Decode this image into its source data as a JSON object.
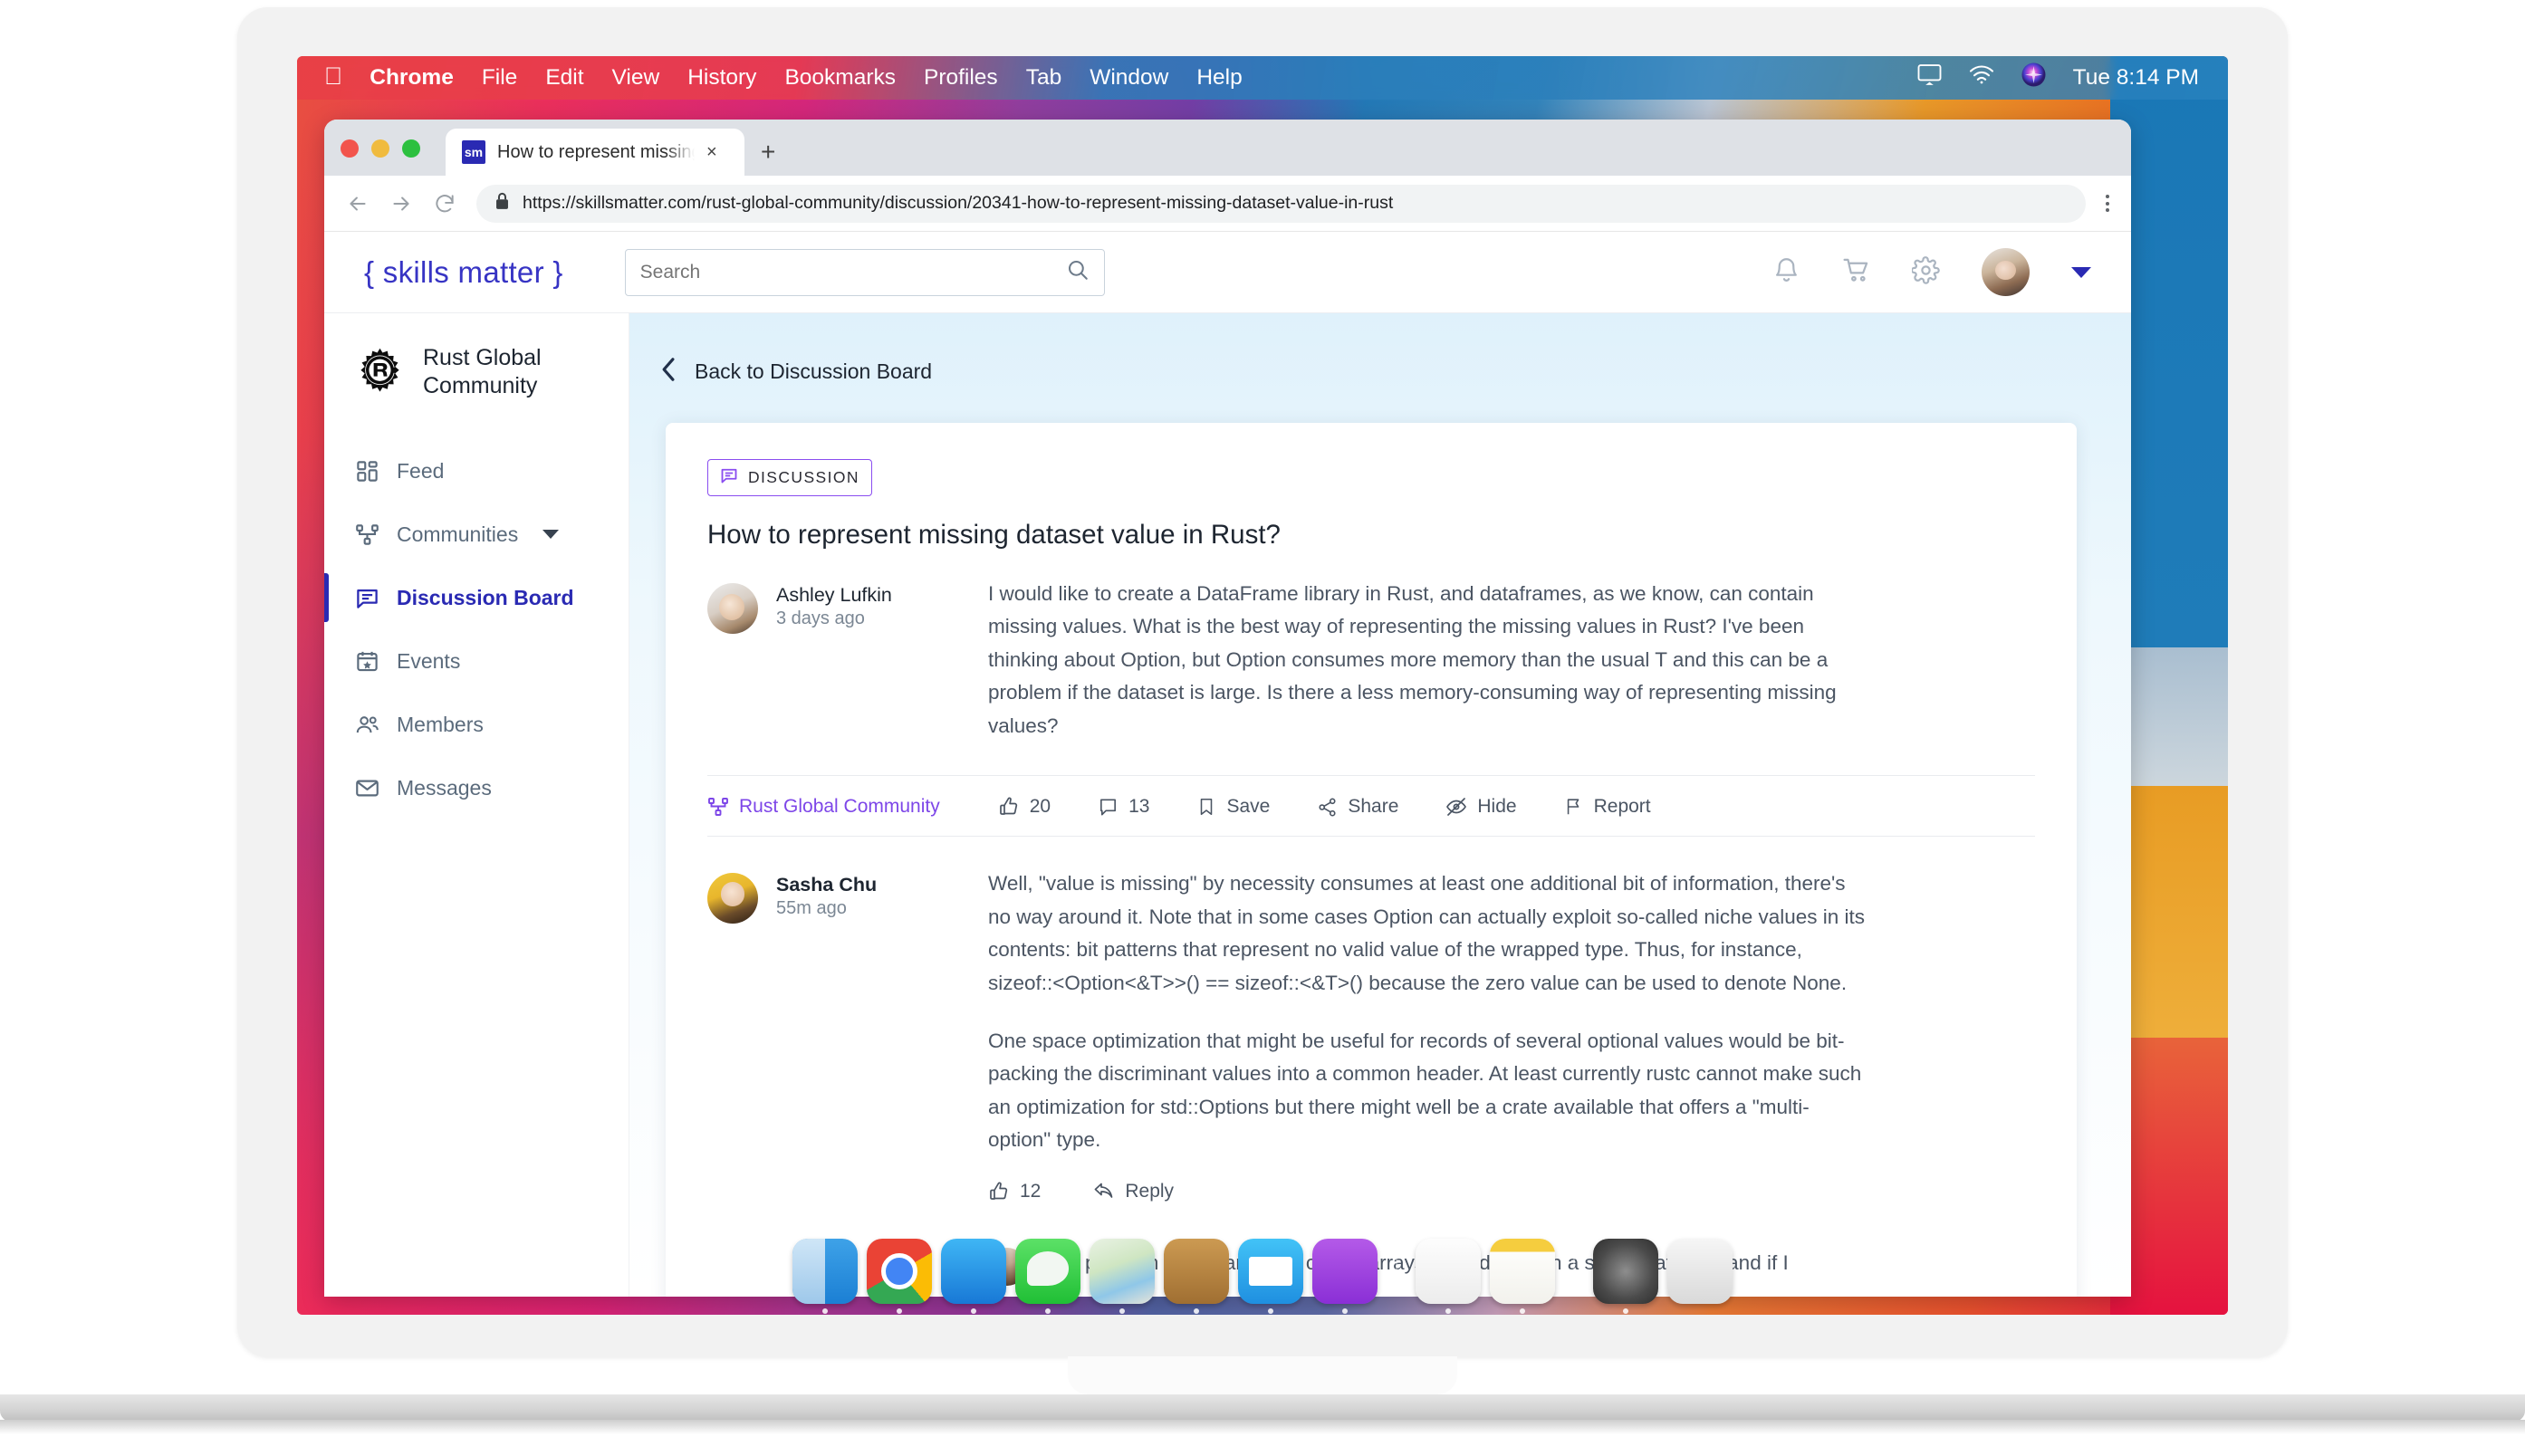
{
  "macos": {
    "apple_logo": "",
    "menu_items": [
      "Chrome",
      "File",
      "Edit",
      "View",
      "History",
      "Bookmarks",
      "Profiles",
      "Tab",
      "Window",
      "Help"
    ],
    "status_icons": [
      "airplay-icon",
      "wifi-icon",
      "siri-icon"
    ],
    "clock": "Tue 8:14 PM"
  },
  "browser": {
    "tab": {
      "favicon_text": "sm",
      "title": "How to represent missing dat",
      "close_label": "×"
    },
    "new_tab_label": "+",
    "nav": {
      "back": "←",
      "forward": "→",
      "reload": "⟳"
    },
    "omnibox": {
      "lock_icon": "lock-icon",
      "url": "https://skillsmatter.com/rust-global-community/discussion/20341-how-to-represent-missing-dataset-value-in-rust"
    },
    "menu_label": "⋮"
  },
  "site_header": {
    "logo": "{ skills matter }",
    "search": {
      "value": "",
      "placeholder": "Search"
    },
    "icons": [
      "bell-icon",
      "cart-icon",
      "gear-icon"
    ],
    "avatar_name": "avatar",
    "caret": "chevron-down-icon"
  },
  "sidebar": {
    "community": {
      "logo": "rust-logo",
      "name": "Rust Global Community"
    },
    "items": [
      {
        "label": "Feed",
        "icon": "grid-icon",
        "active": false,
        "caret": false
      },
      {
        "label": "Communities",
        "icon": "network-icon",
        "active": false,
        "caret": true
      },
      {
        "label": "Discussion Board",
        "icon": "chat-icon",
        "active": true,
        "caret": false
      },
      {
        "label": "Events",
        "icon": "calendar-icon",
        "active": false,
        "caret": false
      },
      {
        "label": "Members",
        "icon": "people-icon",
        "active": false,
        "caret": false
      },
      {
        "label": "Messages",
        "icon": "envelope-icon",
        "active": false,
        "caret": false
      }
    ]
  },
  "main": {
    "back_link": "Back to Discussion Board",
    "badge": "DISCUSSION",
    "post": {
      "title": "How to represent missing dataset value in Rust?",
      "author": "Ashley Lufkin",
      "time": "3 days ago",
      "body": "I would like to create a DataFrame library in Rust, and dataframes, as we know, can contain missing values. What is the best way of representing the missing values in Rust? I've been thinking about Option, but Option consumes more memory than the usual T and this can be a problem if the dataset is large. Is there a less memory-consuming way of representing missing values?"
    },
    "actions": {
      "community": "Rust Global Community",
      "likes": "20",
      "comments": "13",
      "save": "Save",
      "share": "Share",
      "hide": "Hide",
      "report": "Report"
    },
    "reply": {
      "author": "Sasha Chu",
      "time": "55m ago",
      "paragraph1": "Well, \"value is missing\" by necessity consumes at least one additional bit of information, there's no way around it. Note that in some cases Option can actually exploit so-called niche values in its contents: bit patterns that represent no valid value of the wrapped type. Thus, for instance, sizeof::<Option<&T>>() == sizeof::<&T>() because the zero value can be used to denote None.",
      "paragraph2": "One space optimization that might be useful for records of several optional values would be bit-packing the discriminant values into a common header. At least currently rustc cannot make such an optimization for std::Options but there might well be a crate available that offers a \"multi-option\" type.",
      "likes": "12",
      "reply_label": "Reply"
    },
    "nested_reply": {
      "text": "The problem is that any kind of rust arrays should contain a single datatype and if I"
    }
  },
  "dock": {
    "items": [
      {
        "name": "finder",
        "class": "di-finder",
        "running": true
      },
      {
        "name": "chrome",
        "class": "di-chrome",
        "running": true
      },
      {
        "name": "app-store",
        "class": "di-appstore",
        "running": true
      },
      {
        "name": "messages",
        "class": "di-messages",
        "running": true
      },
      {
        "name": "maps",
        "class": "di-maps",
        "running": true
      },
      {
        "name": "contacts",
        "class": "di-contacts",
        "running": true
      },
      {
        "name": "mail",
        "class": "di-mail",
        "running": true
      },
      {
        "name": "podcasts",
        "class": "di-podcasts",
        "running": true
      },
      {
        "name": "reminders",
        "class": "di-reminders",
        "running": true
      },
      {
        "name": "notes",
        "class": "di-notes",
        "running": true
      },
      {
        "name": "settings",
        "class": "di-settings",
        "running": true
      },
      {
        "name": "trash",
        "class": "di-trash",
        "running": false
      }
    ]
  },
  "colors": {
    "brand_purple": "#2a2ab3",
    "badge_purple": "#8a4df0",
    "community_purple": "#7d46e8",
    "text_body": "#4b5563",
    "text_heading": "#1d2530"
  }
}
